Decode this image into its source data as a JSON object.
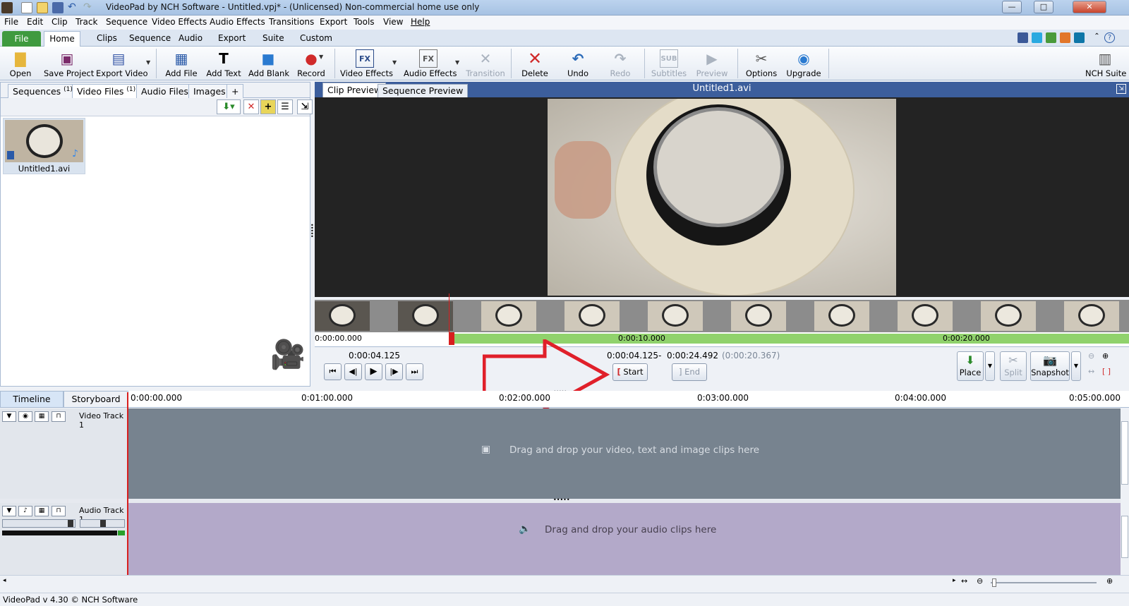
{
  "window": {
    "title": "VideoPad by NCH Software - Untitled.vpj* - (Unlicensed) Non-commercial home use only",
    "controls": [
      "—",
      "□",
      "✕"
    ]
  },
  "menu": [
    "File",
    "Edit",
    "Clip",
    "Track",
    "Sequence",
    "Video Effects",
    "Audio Effects",
    "Transitions",
    "Export",
    "Tools",
    "View",
    "Help"
  ],
  "ribbon_tabs": [
    "File",
    "Home",
    "Clips",
    "Sequence",
    "Audio",
    "Export",
    "Suite",
    "Custom"
  ],
  "toolbar": {
    "open": "Open",
    "save_project": "Save Project",
    "export_video": "Export Video",
    "add_file": "Add File",
    "add_text": "Add Text",
    "add_blank": "Add Blank",
    "record": "Record",
    "video_effects": "Video Effects",
    "audio_effects": "Audio Effects",
    "transition": "Transition",
    "delete": "Delete",
    "undo": "Undo",
    "redo": "Redo",
    "subtitles": "Subtitles",
    "preview": "Preview",
    "options": "Options",
    "upgrade": "Upgrade",
    "nch_suite": "NCH Suite"
  },
  "bins": {
    "tabs": [
      {
        "label": "Sequences",
        "count": "(1)"
      },
      {
        "label": "Video Files",
        "count": "(1)"
      },
      {
        "label": "Audio Files",
        "count": ""
      },
      {
        "label": "Images",
        "count": ""
      },
      {
        "label": "+",
        "count": ""
      }
    ],
    "file_name": "Untitled1.avi"
  },
  "preview": {
    "clip_tab": "Clip Preview",
    "sequence_tab": "Sequence Preview",
    "file_title": "Untitled1.avi",
    "ruler": [
      "0:00:00.000",
      "0:00:10.000",
      "0:00:20.000"
    ],
    "current_time": "0:00:04.125",
    "range_start": "0:00:04.125",
    "range_dash": "-",
    "range_end": "0:00:24.492",
    "range_duration": "(0:00:20.367)",
    "start_label": "Start",
    "end_label": "End",
    "place_label": "Place",
    "split_label": "Split",
    "snapshot_label": "Snapshot"
  },
  "timeline": {
    "tab_timeline": "Timeline",
    "tab_storyboard": "Storyboard",
    "ticks": [
      "0:00:00.000",
      "0:01:00.000",
      "0:02:00.000",
      "0:03:00.000",
      "0:04:00.000",
      "0:05:00.000"
    ],
    "video_track_name": "Video Track 1",
    "video_drop_text": "Drag and drop your video, text and image clips here",
    "audio_track_name": "Audio Track 1",
    "audio_drop_text": "Drag and drop your audio clips here"
  },
  "status": "VideoPad v 4.30 © NCH Software",
  "colors": {
    "accent_blue": "#3c5e9c",
    "file_tab_green": "#3f9a3f",
    "arrow_red": "#e0202a",
    "range_green": "#90d26c"
  }
}
